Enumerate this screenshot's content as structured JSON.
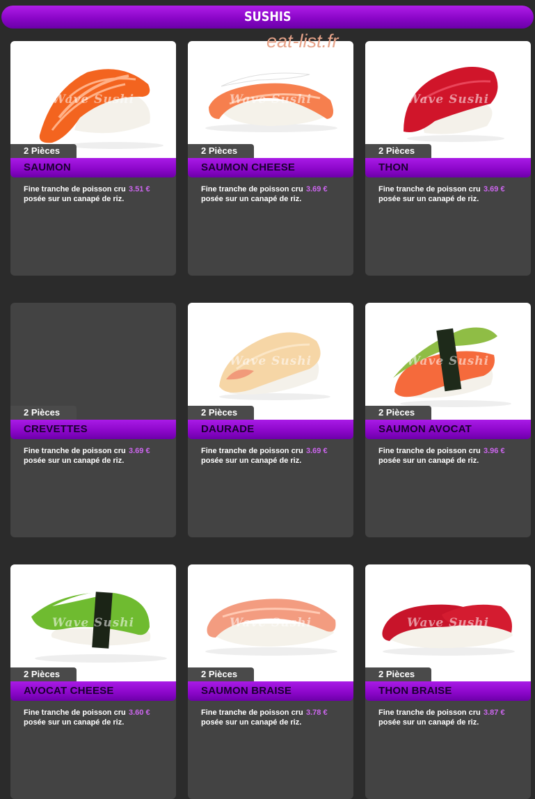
{
  "header": {
    "title": "SUSHIS"
  },
  "watermark": "eat-list.fr",
  "photo_watermark": "Wave Sushi",
  "colors": {
    "accent": "#8a06c8",
    "price": "#cc66ee",
    "card": "#434343",
    "background": "#2b2b2b"
  },
  "items": [
    {
      "name": "SAUMON",
      "pieces": "2 Pièces",
      "desc": "Fine tranche de poisson cru posée sur un canapé de riz.",
      "price": "3.51 €",
      "has_photo": true
    },
    {
      "name": "SAUMON CHEESE",
      "pieces": "2 Pièces",
      "desc": "Fine tranche de poisson cru posée sur un canapé de riz.",
      "price": "3.69 €",
      "has_photo": true
    },
    {
      "name": "THON",
      "pieces": "2 Pièces",
      "desc": "Fine tranche de poisson cru posée sur un canapé de riz.",
      "price": "3.69 €",
      "has_photo": true
    },
    {
      "name": "CREVETTES",
      "pieces": "2 Pièces",
      "desc": "Fine tranche de poisson cru posée sur un canapé de riz.",
      "price": "3.69 €",
      "has_photo": false
    },
    {
      "name": "DAURADE",
      "pieces": "2 Pièces",
      "desc": "Fine tranche de poisson cru posée sur un canapé de riz.",
      "price": "3.69 €",
      "has_photo": true
    },
    {
      "name": "SAUMON AVOCAT",
      "pieces": "2 Pièces",
      "desc": "Fine tranche de poisson cru posée sur un canapé de riz.",
      "price": "3.96 €",
      "has_photo": true
    },
    {
      "name": "AVOCAT CHEESE",
      "pieces": "2 Pièces",
      "desc": "Fine tranche de poisson cru posée sur un canapé de riz.",
      "price": "3.60 €",
      "has_photo": true
    },
    {
      "name": "SAUMON BRAISE",
      "pieces": "2 Pièces",
      "desc": "Fine tranche de poisson cru posée sur un canapé de riz.",
      "price": "3.78 €",
      "has_photo": true
    },
    {
      "name": "THON BRAISE",
      "pieces": "2 Pièces",
      "desc": "Fine tranche de poisson cru posée sur un canapé de riz.",
      "price": "3.87 €",
      "has_photo": true
    }
  ]
}
